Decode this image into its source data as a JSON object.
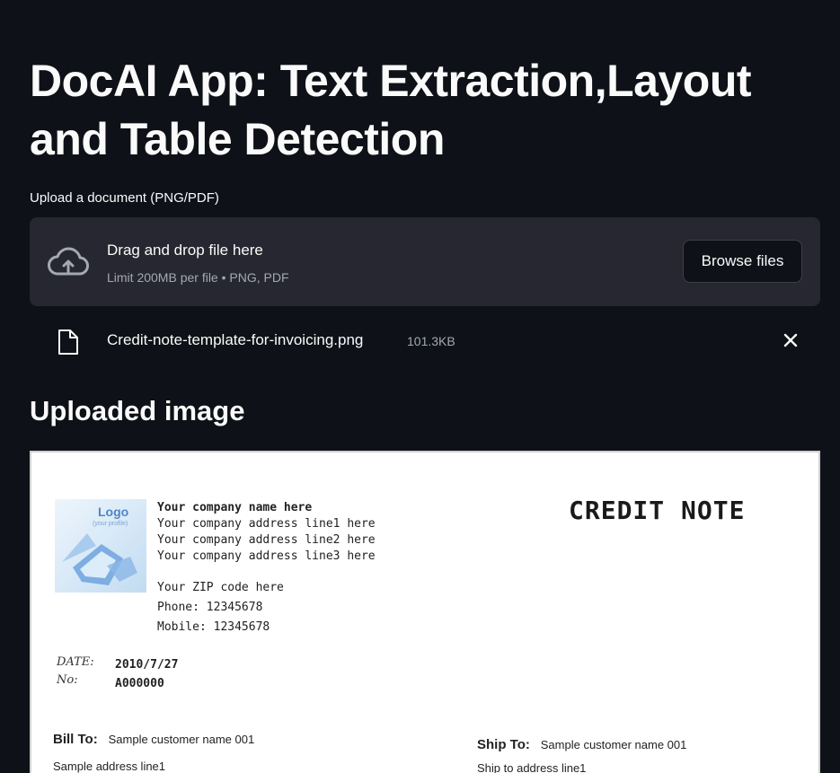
{
  "page": {
    "title": "DocAI App: Text Extraction,Layout and Table Detection"
  },
  "uploader": {
    "label": "Upload a document (PNG/PDF)",
    "drop_text": "Drag and drop file here",
    "limit_text": "Limit 200MB per file • PNG, PDF",
    "browse_label": "Browse files",
    "cloud_icon": "cloud-upload-icon"
  },
  "uploaded_file": {
    "name": "Credit-note-template-for-invoicing.png",
    "size": "101.3KB",
    "file_icon": "file-icon",
    "remove_icon": "close-icon"
  },
  "section": {
    "title": "Uploaded image"
  },
  "document": {
    "logo_text": "Logo",
    "logo_sub": "(your profile)",
    "company_name": "Your company name here",
    "address_lines": [
      "Your company address line1 here",
      "Your company address line2 here",
      "Your company address line3 here"
    ],
    "zip": "Your ZIP code here",
    "phone": "Phone: 12345678",
    "mobile": "Mobile: 12345678",
    "heading": "CREDIT NOTE",
    "date_label": "DATE:",
    "no_label": "No:",
    "date_value": "2010/7/27",
    "no_value": "A000000",
    "bill_to_label": "Bill To:",
    "bill_to_name": "Sample customer name 001",
    "bill_to_address": "Sample address line1",
    "ship_to_label": "Ship To:",
    "ship_to_name": "Sample customer name 001",
    "ship_to_address": "Ship to address line1"
  },
  "colors": {
    "background": "#0e1117",
    "panel": "#262730",
    "text": "#fafafa",
    "muted": "#a3a8b4"
  }
}
